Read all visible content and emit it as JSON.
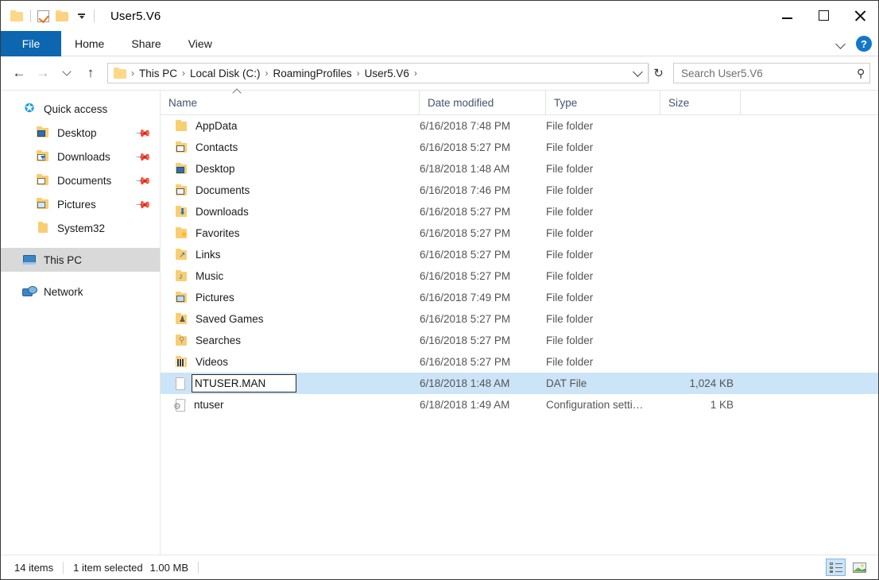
{
  "window": {
    "title": "User5.V6",
    "controls": {
      "minimize": "–",
      "maximize": "□",
      "close": "✕"
    }
  },
  "quick_access_toolbar": {
    "folder_icon": "folder-icon",
    "properties_icon": "checkbox-properties-icon",
    "new_folder_icon": "new-folder-icon",
    "customize_caret": "customize-qat-caret-icon"
  },
  "ribbon": {
    "tabs": [
      {
        "label": "File",
        "active": true
      },
      {
        "label": "Home",
        "active": false
      },
      {
        "label": "Share",
        "active": false
      },
      {
        "label": "View",
        "active": false
      }
    ],
    "expand_icon": "chevron-down-icon",
    "help_label": "?"
  },
  "address_bar": {
    "back_icon": "←",
    "forward_icon": "→",
    "recent_icon": "chevron-down-icon",
    "up_icon": "↑",
    "breadcrumbs": [
      "This PC",
      "Local Disk (C:)",
      "RoamingProfiles",
      "User5.V6"
    ],
    "separator": "›",
    "dropdown_icon": "chevron-down-icon",
    "refresh_icon": "↻",
    "refresh_label": "Refresh"
  },
  "search": {
    "placeholder": "Search User5.V6",
    "value": "",
    "icon": "search-icon"
  },
  "sidebar": {
    "items": [
      {
        "label": "Quick access",
        "icon": "star-icon",
        "level": "root",
        "pinned": false,
        "selected": false
      },
      {
        "label": "Desktop",
        "icon": "folder-desktop-icon",
        "level": "child",
        "pinned": true,
        "selected": false
      },
      {
        "label": "Downloads",
        "icon": "folder-downloads-icon",
        "level": "child",
        "pinned": true,
        "selected": false
      },
      {
        "label": "Documents",
        "icon": "folder-documents-icon",
        "level": "child",
        "pinned": true,
        "selected": false
      },
      {
        "label": "Pictures",
        "icon": "folder-pictures-icon",
        "level": "child",
        "pinned": true,
        "selected": false
      },
      {
        "label": "System32",
        "icon": "folder-icon",
        "level": "child",
        "pinned": false,
        "selected": false
      },
      {
        "label": "This PC",
        "icon": "this-pc-icon",
        "level": "root",
        "pinned": false,
        "selected": true
      },
      {
        "label": "Network",
        "icon": "network-icon",
        "level": "root",
        "pinned": false,
        "selected": false
      }
    ]
  },
  "file_list": {
    "columns": [
      {
        "label": "Name",
        "sorted": "ascending"
      },
      {
        "label": "Date modified",
        "sorted": ""
      },
      {
        "label": "Type",
        "sorted": ""
      },
      {
        "label": "Size",
        "sorted": ""
      }
    ],
    "sort_indicator": "sort-ascending-icon",
    "rows": [
      {
        "name": "AppData",
        "date": "6/16/2018 7:48 PM",
        "type": "File folder",
        "size": "",
        "icon": "folder-icon",
        "selected": false,
        "editing": false
      },
      {
        "name": "Contacts",
        "date": "6/16/2018 5:27 PM",
        "type": "File folder",
        "size": "",
        "icon": "folder-contacts-icon",
        "selected": false,
        "editing": false
      },
      {
        "name": "Desktop",
        "date": "6/18/2018 1:48 AM",
        "type": "File folder",
        "size": "",
        "icon": "folder-desktop-icon",
        "selected": false,
        "editing": false
      },
      {
        "name": "Documents",
        "date": "6/16/2018 7:46 PM",
        "type": "File folder",
        "size": "",
        "icon": "folder-documents-icon",
        "selected": false,
        "editing": false
      },
      {
        "name": "Downloads",
        "date": "6/16/2018 5:27 PM",
        "type": "File folder",
        "size": "",
        "icon": "folder-downloads-icon",
        "selected": false,
        "editing": false
      },
      {
        "name": "Favorites",
        "date": "6/16/2018 5:27 PM",
        "type": "File folder",
        "size": "",
        "icon": "folder-favorites-icon",
        "selected": false,
        "editing": false
      },
      {
        "name": "Links",
        "date": "6/16/2018 5:27 PM",
        "type": "File folder",
        "size": "",
        "icon": "folder-links-icon",
        "selected": false,
        "editing": false
      },
      {
        "name": "Music",
        "date": "6/16/2018 5:27 PM",
        "type": "File folder",
        "size": "",
        "icon": "folder-music-icon",
        "selected": false,
        "editing": false
      },
      {
        "name": "Pictures",
        "date": "6/16/2018 7:49 PM",
        "type": "File folder",
        "size": "",
        "icon": "folder-pictures-icon",
        "selected": false,
        "editing": false
      },
      {
        "name": "Saved Games",
        "date": "6/16/2018 5:27 PM",
        "type": "File folder",
        "size": "",
        "icon": "folder-savedgames-icon",
        "selected": false,
        "editing": false
      },
      {
        "name": "Searches",
        "date": "6/16/2018 5:27 PM",
        "type": "File folder",
        "size": "",
        "icon": "folder-searches-icon",
        "selected": false,
        "editing": false
      },
      {
        "name": "Videos",
        "date": "6/16/2018 5:27 PM",
        "type": "File folder",
        "size": "",
        "icon": "folder-videos-icon",
        "selected": false,
        "editing": false
      },
      {
        "name": "NTUSER.MAN",
        "date": "6/18/2018 1:48 AM",
        "type": "DAT File",
        "size": "1,024 KB",
        "icon": "dat-file-icon",
        "selected": true,
        "editing": true
      },
      {
        "name": "ntuser",
        "date": "6/18/2018 1:49 AM",
        "type": "Configuration setti…",
        "size": "1 KB",
        "icon": "config-file-icon",
        "selected": false,
        "editing": false
      }
    ]
  },
  "rename_editor": {
    "value": "NTUSER.MAN",
    "active": true
  },
  "status_bar": {
    "item_count": "14 items",
    "selection_count": "1 item selected",
    "selection_size": "1.00 MB",
    "view_details_icon": "details-view-icon",
    "view_large_icons_icon": "large-icons-view-icon",
    "active_view": "details"
  },
  "colors": {
    "accent_blue": "#0c66b0",
    "selection_blue": "#cce4f7",
    "sidebar_selection_gray": "#d9d9d9",
    "folder_yellow": "#f9ce72",
    "help_blue": "#1477c8"
  }
}
